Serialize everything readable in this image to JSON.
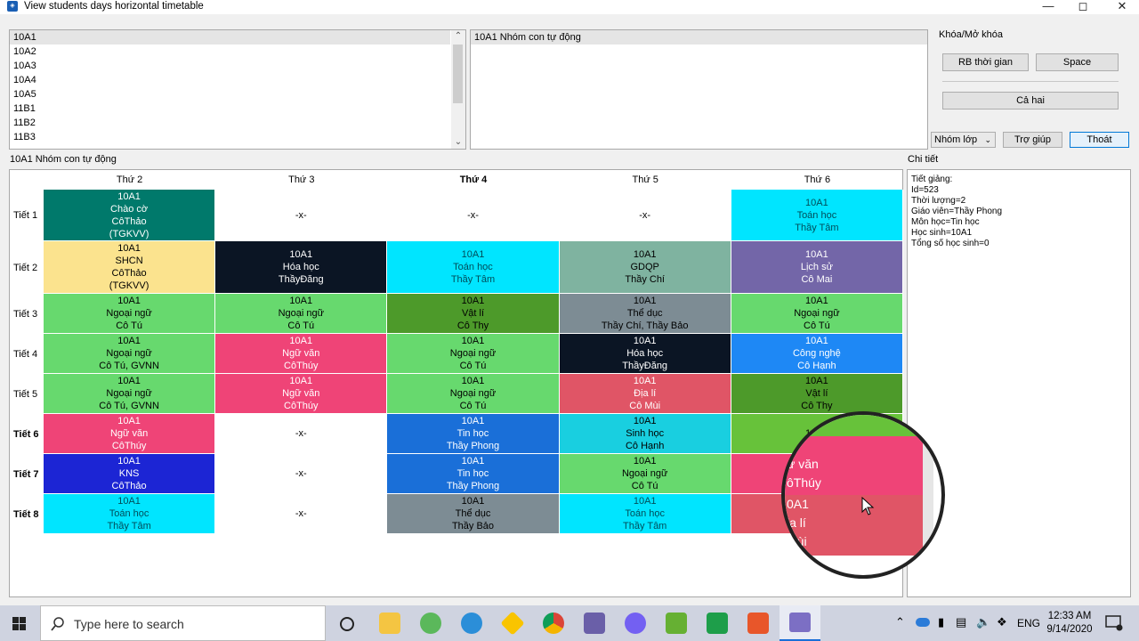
{
  "window": {
    "title": "View students days horizontal timetable"
  },
  "classes": [
    "10A1",
    "10A2",
    "10A3",
    "10A4",
    "10A5",
    "11B1",
    "11B2",
    "11B3"
  ],
  "groups": [
    "10A1 Nhóm con tự động"
  ],
  "lock": {
    "title": "Khóa/Mở khóa",
    "rb": "RB thời gian",
    "space": "Space",
    "both": "Cả hai"
  },
  "controls": {
    "combo": "Nhóm lớp",
    "help": "Trợ giúp",
    "exit": "Thoát"
  },
  "grid_label": "10A1 Nhóm con tự động",
  "detail": {
    "title": "Chi tiết",
    "lines": [
      "Tiết giảng:",
      "Id=523",
      "Thời lượng=2",
      "Giáo viên=Thầy Phong",
      "Môn học=Tin học",
      "Học sinh=10A1",
      "Tổng số học sinh=0"
    ]
  },
  "days": [
    "Thứ 2",
    "Thứ 3",
    "Thứ 4",
    "Thứ 5",
    "Thứ 6"
  ],
  "periods": [
    "Tiết 1",
    "Tiết 2",
    "Tiết 3",
    "Tiết 4",
    "Tiết 5",
    "Tiết 6",
    "Tiết 7",
    "Tiết 8"
  ],
  "cells": [
    [
      {
        "lines": [
          "10A1",
          "Chào cờ",
          "CôThảo",
          "(TGKVV)"
        ],
        "bg": "#00796b",
        "fg": "#ffffff"
      },
      {
        "lines": [
          "-x-"
        ],
        "bg": "#ffffff",
        "fg": "#000000"
      },
      {
        "lines": [
          "-x-"
        ],
        "bg": "#ffffff",
        "fg": "#000000"
      },
      {
        "lines": [
          "-x-"
        ],
        "bg": "#ffffff",
        "fg": "#000000"
      },
      {
        "lines": [
          "10A1",
          "Toán học",
          "Thầy Tâm"
        ],
        "bg": "#00e5ff",
        "fg": "#004d5a"
      }
    ],
    [
      {
        "lines": [
          "10A1",
          "SHCN",
          "CôThảo",
          "(TGKVV)"
        ],
        "bg": "#fbe38e",
        "fg": "#000000"
      },
      {
        "lines": [
          "10A1",
          "Hóa học",
          "ThầyĐăng"
        ],
        "bg": "#0b1524",
        "fg": "#ffffff"
      },
      {
        "lines": [
          "10A1",
          "Toán học",
          "Thầy Tâm"
        ],
        "bg": "#00e5ff",
        "fg": "#004d5a"
      },
      {
        "lines": [
          "10A1",
          "GDQP",
          "Thầy Chí"
        ],
        "bg": "#7fb3a0",
        "fg": "#000000"
      },
      {
        "lines": [
          "10A1",
          "Lịch sử",
          "Cô Mai"
        ],
        "bg": "#7366a8",
        "fg": "#ffffff"
      }
    ],
    [
      {
        "lines": [
          "10A1",
          "Ngoại ngữ",
          "Cô Tú"
        ],
        "bg": "#67d96e",
        "fg": "#000000"
      },
      {
        "lines": [
          "10A1",
          "Ngoại ngữ",
          "Cô Tú"
        ],
        "bg": "#67d96e",
        "fg": "#000000"
      },
      {
        "lines": [
          "10A1",
          "Vật lí",
          "Cô Thy"
        ],
        "bg": "#4d9a2a",
        "fg": "#000000"
      },
      {
        "lines": [
          "10A1",
          "Thể dục",
          "Thầy Chí, Thầy Bảo"
        ],
        "bg": "#7d8c94",
        "fg": "#000000"
      },
      {
        "lines": [
          "10A1",
          "Ngoại ngữ",
          "Cô Tú"
        ],
        "bg": "#67d96e",
        "fg": "#000000"
      }
    ],
    [
      {
        "lines": [
          "10A1",
          "Ngoại ngữ",
          "Cô Tú, GVNN"
        ],
        "bg": "#67d96e",
        "fg": "#000000"
      },
      {
        "lines": [
          "10A1",
          "Ngữ văn",
          "CôThúy"
        ],
        "bg": "#ef4477",
        "fg": "#ffffff"
      },
      {
        "lines": [
          "10A1",
          "Ngoại ngữ",
          "Cô Tú"
        ],
        "bg": "#67d96e",
        "fg": "#000000"
      },
      {
        "lines": [
          "10A1",
          "Hóa học",
          "ThầyĐăng"
        ],
        "bg": "#0b1524",
        "fg": "#ffffff"
      },
      {
        "lines": [
          "10A1",
          "Công nghệ",
          "Cô Hạnh"
        ],
        "bg": "#1e88f5",
        "fg": "#ffffff"
      }
    ],
    [
      {
        "lines": [
          "10A1",
          "Ngoại ngữ",
          "Cô Tú, GVNN"
        ],
        "bg": "#67d96e",
        "fg": "#000000"
      },
      {
        "lines": [
          "10A1",
          "Ngữ văn",
          "CôThúy"
        ],
        "bg": "#ef4477",
        "fg": "#ffffff"
      },
      {
        "lines": [
          "10A1",
          "Ngoại ngữ",
          "Cô Tú"
        ],
        "bg": "#67d96e",
        "fg": "#000000"
      },
      {
        "lines": [
          "10A1",
          "Địa lí",
          "Cô Mùi"
        ],
        "bg": "#e05566",
        "fg": "#ffffff"
      },
      {
        "lines": [
          "10A1",
          "Vật lí",
          "Cô Thy"
        ],
        "bg": "#4d9a2a",
        "fg": "#000000"
      }
    ],
    [
      {
        "lines": [
          "10A1",
          "Ngữ văn",
          "CôThúy"
        ],
        "bg": "#ef4477",
        "fg": "#ffffff"
      },
      {
        "lines": [
          "-x-"
        ],
        "bg": "#ffffff",
        "fg": "#000000"
      },
      {
        "lines": [
          "10A1",
          "Tin học",
          "Thầy Phong"
        ],
        "bg": "#1a6fd8",
        "fg": "#ffffff"
      },
      {
        "lines": [
          "10A1",
          "Sinh học",
          "Cô Hạnh"
        ],
        "bg": "#19cfe0",
        "fg": "#000000"
      },
      {
        "lines": [
          "10A1"
        ],
        "bg": "#67c23a",
        "fg": "#000000"
      }
    ],
    [
      {
        "lines": [
          "10A1",
          "KNS",
          "CôThảo"
        ],
        "bg": "#1c25d4",
        "fg": "#ffffff"
      },
      {
        "lines": [
          "-x-"
        ],
        "bg": "#ffffff",
        "fg": "#000000"
      },
      {
        "lines": [
          "10A1",
          "Tin học",
          "Thầy Phong"
        ],
        "bg": "#1a6fd8",
        "fg": "#ffffff"
      },
      {
        "lines": [
          "10A1",
          "Ngoại ngữ",
          "Cô Tú"
        ],
        "bg": "#67d96e",
        "fg": "#000000"
      },
      {
        "lines": [],
        "bg": "#ef4477",
        "fg": "#ffffff"
      }
    ],
    [
      {
        "lines": [
          "10A1",
          "Toán học",
          "Thầy Tâm"
        ],
        "bg": "#00e5ff",
        "fg": "#004d5a"
      },
      {
        "lines": [
          "-x-"
        ],
        "bg": "#ffffff",
        "fg": "#000000"
      },
      {
        "lines": [
          "10A1",
          "Thể dục",
          "Thầy Bảo"
        ],
        "bg": "#7d8c94",
        "fg": "#000000"
      },
      {
        "lines": [
          "10A1",
          "Toán học",
          "Thầy Tâm"
        ],
        "bg": "#00e5ff",
        "fg": "#004d5a"
      },
      {
        "lines": [],
        "bg": "#e05566",
        "fg": "#ffffff"
      }
    ]
  ],
  "magnifier": {
    "top": {
      "lines": [
        "1",
        "ữ văn",
        "ôThúy"
      ],
      "bg": "#ef4477"
    },
    "bottom": {
      "lines": [
        "0A1",
        "ịa lí",
        "Mùi"
      ],
      "bg": "#e05566"
    }
  },
  "taskbar": {
    "search_placeholder": "Type here to search",
    "time": "12:33 AM",
    "date": "9/14/2020",
    "lang": "ENG"
  }
}
